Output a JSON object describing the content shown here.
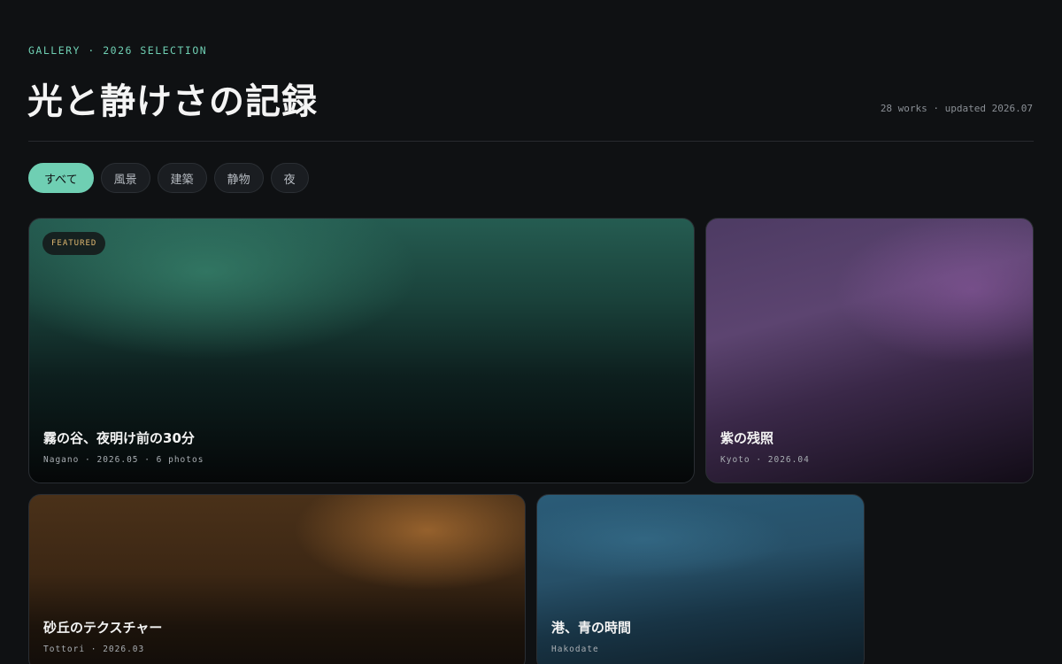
{
  "header": {
    "eyebrow": "GALLERY · 2026 SELECTION",
    "title": "光と静けさの記録",
    "meta": "28 works · updated 2026.07"
  },
  "filters": [
    "すべて",
    "風景",
    "建築",
    "静物",
    "夜"
  ],
  "active_filter": "すべて",
  "cards": [
    {
      "badge": "FEATURED",
      "title": "霧の谷、夜明け前の30分",
      "sub": "Nagano · 2026.05 · 6 photos"
    },
    {
      "title": "紫の残照",
      "sub": "Kyoto · 2026.04"
    },
    {
      "title": "砂丘のテクスチャー",
      "sub": "Tottori · 2026.03"
    },
    {
      "title": "港、青の時間",
      "sub": "Hakodate"
    }
  ],
  "colors": {
    "background": "#0f1113",
    "accent": "#6fcfb3",
    "badge_text": "#e0b870"
  }
}
